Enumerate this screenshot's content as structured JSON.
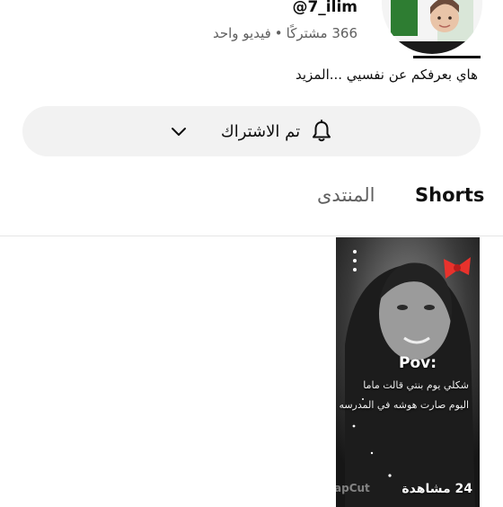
{
  "channel": {
    "handle": "@7_ilim",
    "subscribers": "366 مشتركًا",
    "separator": "•",
    "videos": "فيديو واحد",
    "bio": "هاي بعرفكم عن نفسيي ...المزيد"
  },
  "subscribe": {
    "label": "تم الاشتراك",
    "bell_icon": "bell-icon",
    "chevron_icon": "chevron-down-icon"
  },
  "tabs": [
    {
      "label": "Shorts",
      "active": true
    },
    {
      "label": "المنتدى",
      "active": false
    }
  ],
  "short": {
    "overlay_title": "Pov:",
    "overlay_line1": "شكلي يوم بنتي قالت ماما",
    "overlay_line2": "اليوم صارت هوشه في المدرسه",
    "watermark": "apCut",
    "views": "24 مشاهدة",
    "menu_icon": "more-vert-icon"
  },
  "colors": {
    "text_primary": "#0f0f0f",
    "text_secondary": "#606060",
    "button_bg": "#f2f2f2",
    "bow": "#e8322c"
  }
}
